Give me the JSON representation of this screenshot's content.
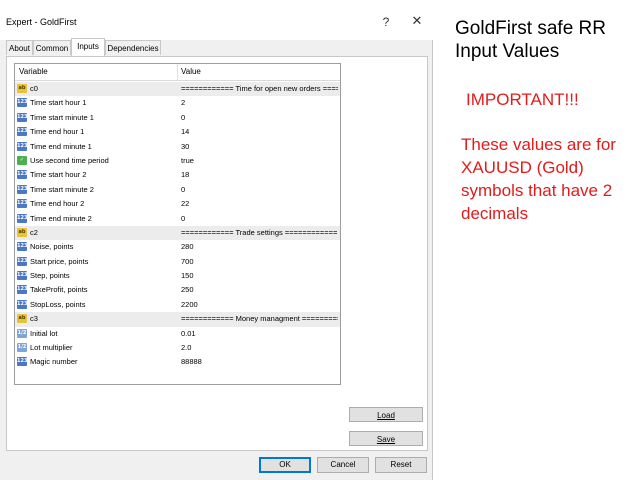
{
  "window": {
    "title": "Expert - GoldFirst",
    "help_label": "?",
    "close_label": "✕"
  },
  "tabs": [
    {
      "label": "About",
      "active": false
    },
    {
      "label": "Common",
      "active": false
    },
    {
      "label": "Inputs",
      "active": true
    },
    {
      "label": "Dependencies",
      "active": false
    }
  ],
  "grid": {
    "header_variable": "Variable",
    "header_value": "Value",
    "rows": [
      {
        "type": "group",
        "icon": "ab",
        "name": "c0",
        "value": "============ Time for open new orders ==========="
      },
      {
        "type": "param",
        "icon": "num",
        "name": "Time start hour 1",
        "value": "2"
      },
      {
        "type": "param",
        "icon": "num",
        "name": "Time start minute 1",
        "value": "0"
      },
      {
        "type": "param",
        "icon": "num",
        "name": "Time end hour 1",
        "value": "14"
      },
      {
        "type": "param",
        "icon": "num",
        "name": "Time end minute 1",
        "value": "30"
      },
      {
        "type": "param",
        "icon": "bool",
        "name": "Use second time period",
        "value": "true"
      },
      {
        "type": "param",
        "icon": "num",
        "name": "Time start hour 2",
        "value": "18"
      },
      {
        "type": "param",
        "icon": "num",
        "name": "Time start minute 2",
        "value": "0"
      },
      {
        "type": "param",
        "icon": "num",
        "name": "Time end hour 2",
        "value": "22"
      },
      {
        "type": "param",
        "icon": "num",
        "name": "Time end minute 2",
        "value": "0"
      },
      {
        "type": "group",
        "icon": "ab",
        "name": "c2",
        "value": "============ Trade settings ============"
      },
      {
        "type": "param",
        "icon": "num",
        "name": "Noise, points",
        "value": "280"
      },
      {
        "type": "param",
        "icon": "num",
        "name": "Start price, points",
        "value": "700"
      },
      {
        "type": "param",
        "icon": "num",
        "name": "Step, points",
        "value": "150"
      },
      {
        "type": "param",
        "icon": "num",
        "name": "TakeProfit, points",
        "value": "250"
      },
      {
        "type": "param",
        "icon": "num",
        "name": "StopLoss, points",
        "value": "2200"
      },
      {
        "type": "group",
        "icon": "ab",
        "name": "c3",
        "value": "============ Money managment ============"
      },
      {
        "type": "param",
        "icon": "dbl",
        "name": "Initial lot",
        "value": "0.01"
      },
      {
        "type": "param",
        "icon": "dbl",
        "name": "Lot multiplier",
        "value": "2.0"
      },
      {
        "type": "param",
        "icon": "num",
        "name": "Magic number",
        "value": "88888"
      }
    ]
  },
  "buttons": {
    "load": "Load",
    "save": "Save",
    "ok": "OK",
    "cancel": "Cancel",
    "reset": "Reset"
  },
  "side": {
    "title": "GoldFirst safe RR Input Values",
    "important": "IMPORTANT!!!",
    "note": "These values are for XAUUSD (Gold) symbols that have 2 decimals"
  },
  "colors": {
    "note_red": "#e21b1b",
    "ok_border": "#0078d7"
  }
}
